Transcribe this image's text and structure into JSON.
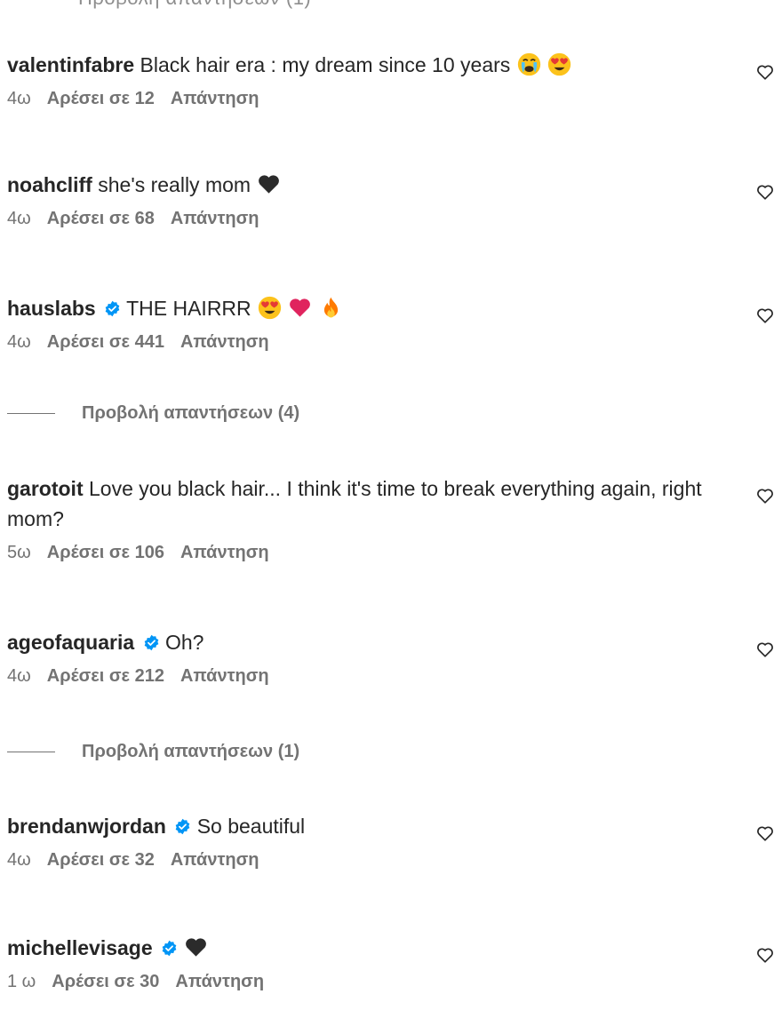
{
  "top_partial": "Προβολή απαντήσεων (1)",
  "comments": [
    {
      "username": "valentinfabre",
      "text": "Black hair era : my dream since 10 years",
      "time": "4ω",
      "likes": "Αρέσει σε 12",
      "reply": "Απάντηση"
    },
    {
      "username": "noahcliff",
      "text": "she's really mom",
      "time": "4ω",
      "likes": "Αρέσει σε 68",
      "reply": "Απάντηση"
    },
    {
      "username": "hauslabs",
      "text": "THE HAIRRR",
      "time": "4ω",
      "likes": "Αρέσει σε 441",
      "reply": "Απάντηση"
    },
    {
      "username": "garotoit",
      "text": "Love you black hair... I think it's time to break everything again, right mom?",
      "time": "5ω",
      "likes": "Αρέσει σε 106",
      "reply": "Απάντηση"
    },
    {
      "username": "ageofaquaria",
      "text": "Oh?",
      "time": "4ω",
      "likes": "Αρέσει σε 212",
      "reply": "Απάντηση"
    },
    {
      "username": "brendanwjordan",
      "text": "So beautiful",
      "time": "4ω",
      "likes": "Αρέσει σε 32",
      "reply": "Απάντηση"
    },
    {
      "username": "michellevisage",
      "text": "",
      "time": "1 ω",
      "likes": "Αρέσει σε 30",
      "reply": "Απάντηση"
    }
  ],
  "view_replies": [
    "Προβολή απαντήσεων (4)",
    "Προβολή απαντήσεων (1)"
  ],
  "colors": {
    "text": "#262626",
    "secondary": "#737373",
    "verified": "#0095f6",
    "heart_red": "#e0245e"
  }
}
